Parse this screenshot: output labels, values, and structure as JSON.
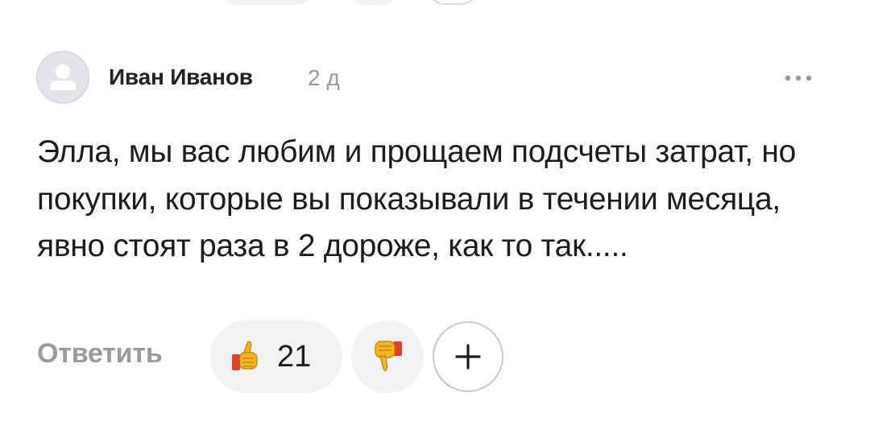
{
  "comment": {
    "author": "Иван Иванов",
    "time": "2 д",
    "text": "Элла, мы вас любим и прощаем подсчеты затрат, но покупки, которые вы показывали в течении месяца, явно стоят раза в 2 дороже, как то так.....",
    "avatar_icon": "user-placeholder-icon",
    "more_icon": "more-horizontal-icon"
  },
  "actions": {
    "reply_label": "Ответить",
    "likes": {
      "icon": "thumbs-up-icon",
      "count": "21"
    },
    "dislike_icon": "thumbs-down-icon",
    "add_reaction_icon": "plus-icon"
  },
  "colors": {
    "muted": "#9b9b9b",
    "pill_bg": "#f2f2f2",
    "emoji_yellow": "#f6b41e",
    "emoji_red": "#e0432b"
  }
}
